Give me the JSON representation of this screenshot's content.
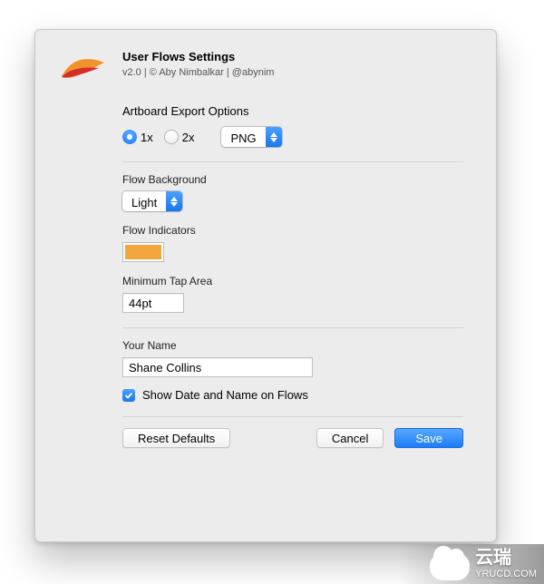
{
  "header": {
    "title": "User Flows Settings",
    "subtitle": "v2.0 | © Aby Nimbalkar | @abynim"
  },
  "export": {
    "label": "Artboard Export Options",
    "scale_1x": "1x",
    "scale_2x": "2x",
    "selected_scale": "1x",
    "format": "PNG"
  },
  "flow_bg": {
    "label": "Flow Background",
    "value": "Light"
  },
  "indicators": {
    "label": "Flow Indicators",
    "color": "#f3a63c"
  },
  "tap_area": {
    "label": "Minimum Tap Area",
    "value": "44pt"
  },
  "name": {
    "label": "Your Name",
    "value": "Shane Collins"
  },
  "show_date": {
    "label": "Show Date and Name on Flows",
    "checked": true
  },
  "buttons": {
    "reset": "Reset Defaults",
    "cancel": "Cancel",
    "save": "Save"
  },
  "watermark": {
    "cn": "云瑞",
    "domain": "YRUCD.COM"
  }
}
